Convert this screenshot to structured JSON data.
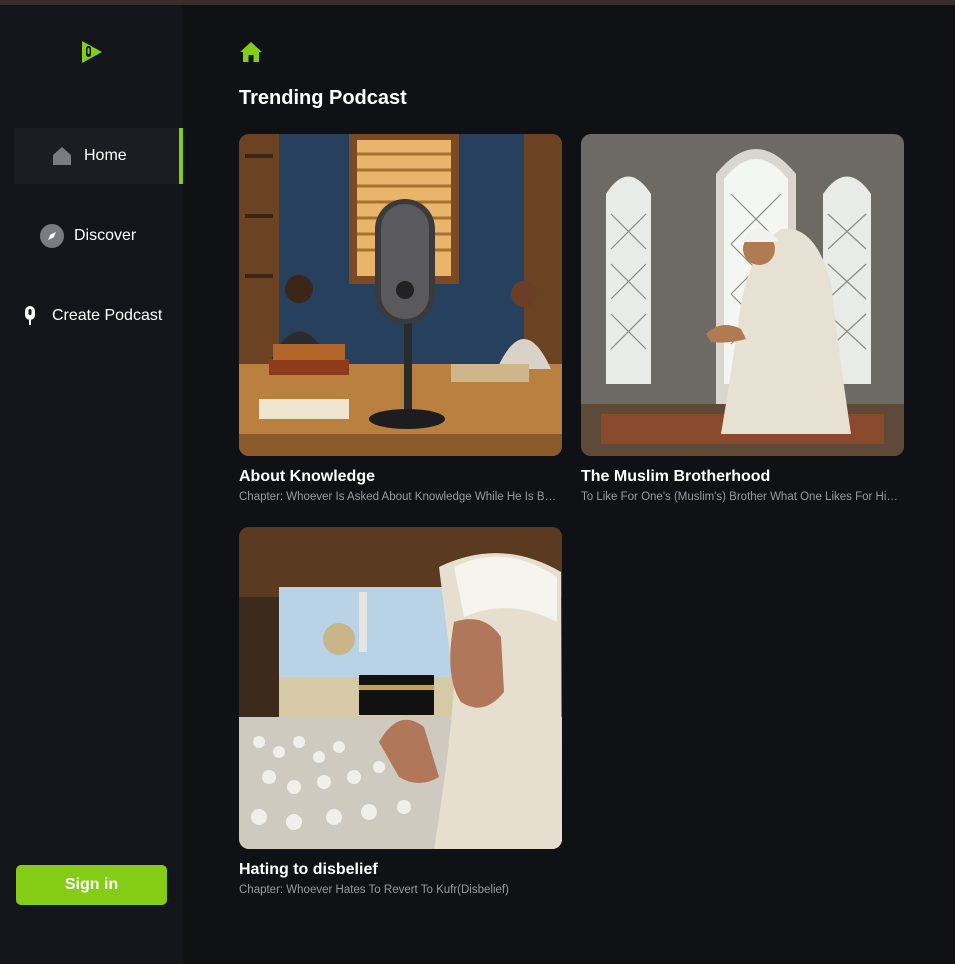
{
  "app": {
    "accent": "#84cc16"
  },
  "sidebar": {
    "items": [
      {
        "label": "Home",
        "icon": "home-icon",
        "active": true
      },
      {
        "label": "Discover",
        "icon": "compass-icon",
        "active": false
      },
      {
        "label": "Create Podcast",
        "icon": "microphone-icon",
        "active": false
      }
    ],
    "signin_label": "Sign in"
  },
  "main": {
    "section_title": "Trending Podcast",
    "podcasts": [
      {
        "title": "About Knowledge",
        "description": "Chapter: Whoever Is Asked About Knowledge While He Is Busy In Talking",
        "image": "microphone-library-scene"
      },
      {
        "title": "The Muslim Brotherhood",
        "description": "To Like For One's (Muslim's) Brother What One Likes For Himself",
        "image": "man-praying-by-window"
      },
      {
        "title": "Hating to disbelief",
        "description": "Chapter: Whoever Hates To Revert To Kufr(Disbelief)",
        "image": "pilgrim-praying-at-kaaba"
      }
    ]
  }
}
